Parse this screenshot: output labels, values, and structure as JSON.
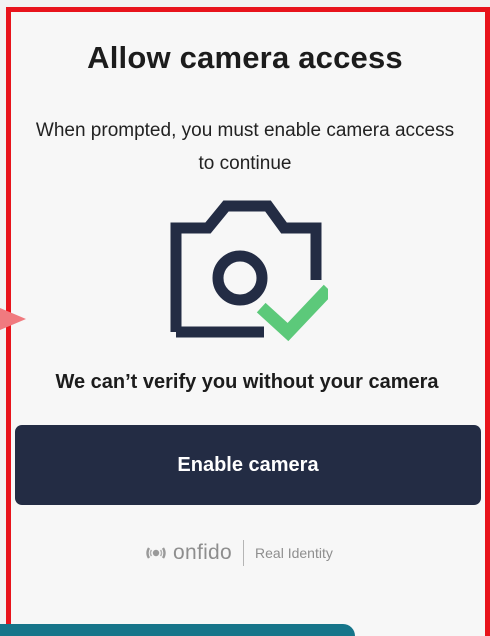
{
  "dialog": {
    "title": "Allow camera access",
    "subtitle": "When prompted, you must enable camera access to continue",
    "illustration": "camera-check-icon",
    "warning": "We can’t verify you without your camera",
    "enable_button_label": "Enable camera"
  },
  "footer": {
    "brand_name": "onfido",
    "tagline": "Real Identity",
    "logo_icon": "onfido-logo-icon"
  },
  "colors": {
    "accent": "#e8141c",
    "button": "#232c44",
    "check": "#5cc97a",
    "camera": "#232c44"
  }
}
